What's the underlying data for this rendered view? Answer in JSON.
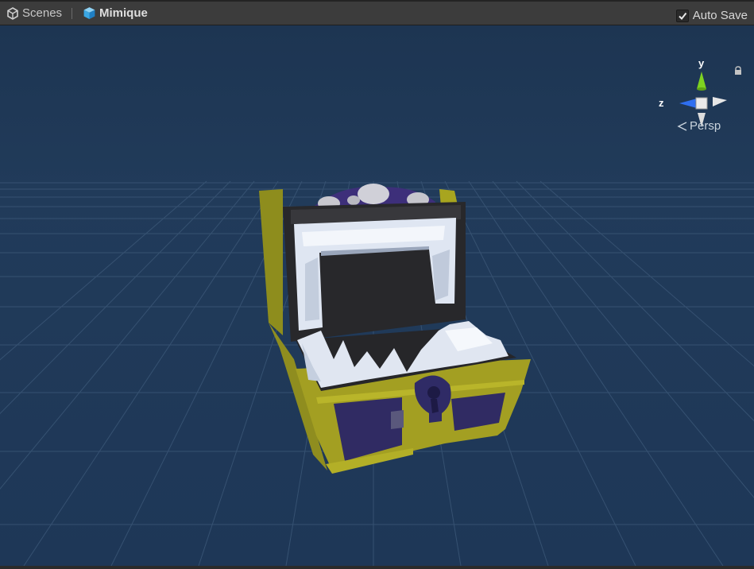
{
  "header": {
    "scenes_label": "Scenes",
    "scene_name": "Mimique",
    "autosave_label": "Auto Save",
    "autosave_checked": true
  },
  "gizmo": {
    "y_label": "y",
    "z_label": "z",
    "projection_label": "Persp"
  },
  "colors": {
    "background": "#1f3654",
    "grid": "#3b5776",
    "chest_gold": "#9c9a20",
    "chest_panel": "#302b63",
    "interior": "#2b2b2d",
    "teeth": "#dfe6f2",
    "axis_y": "#7ed321",
    "axis_z": "#2f6ff0",
    "axis_x": "#e6e6e6"
  }
}
